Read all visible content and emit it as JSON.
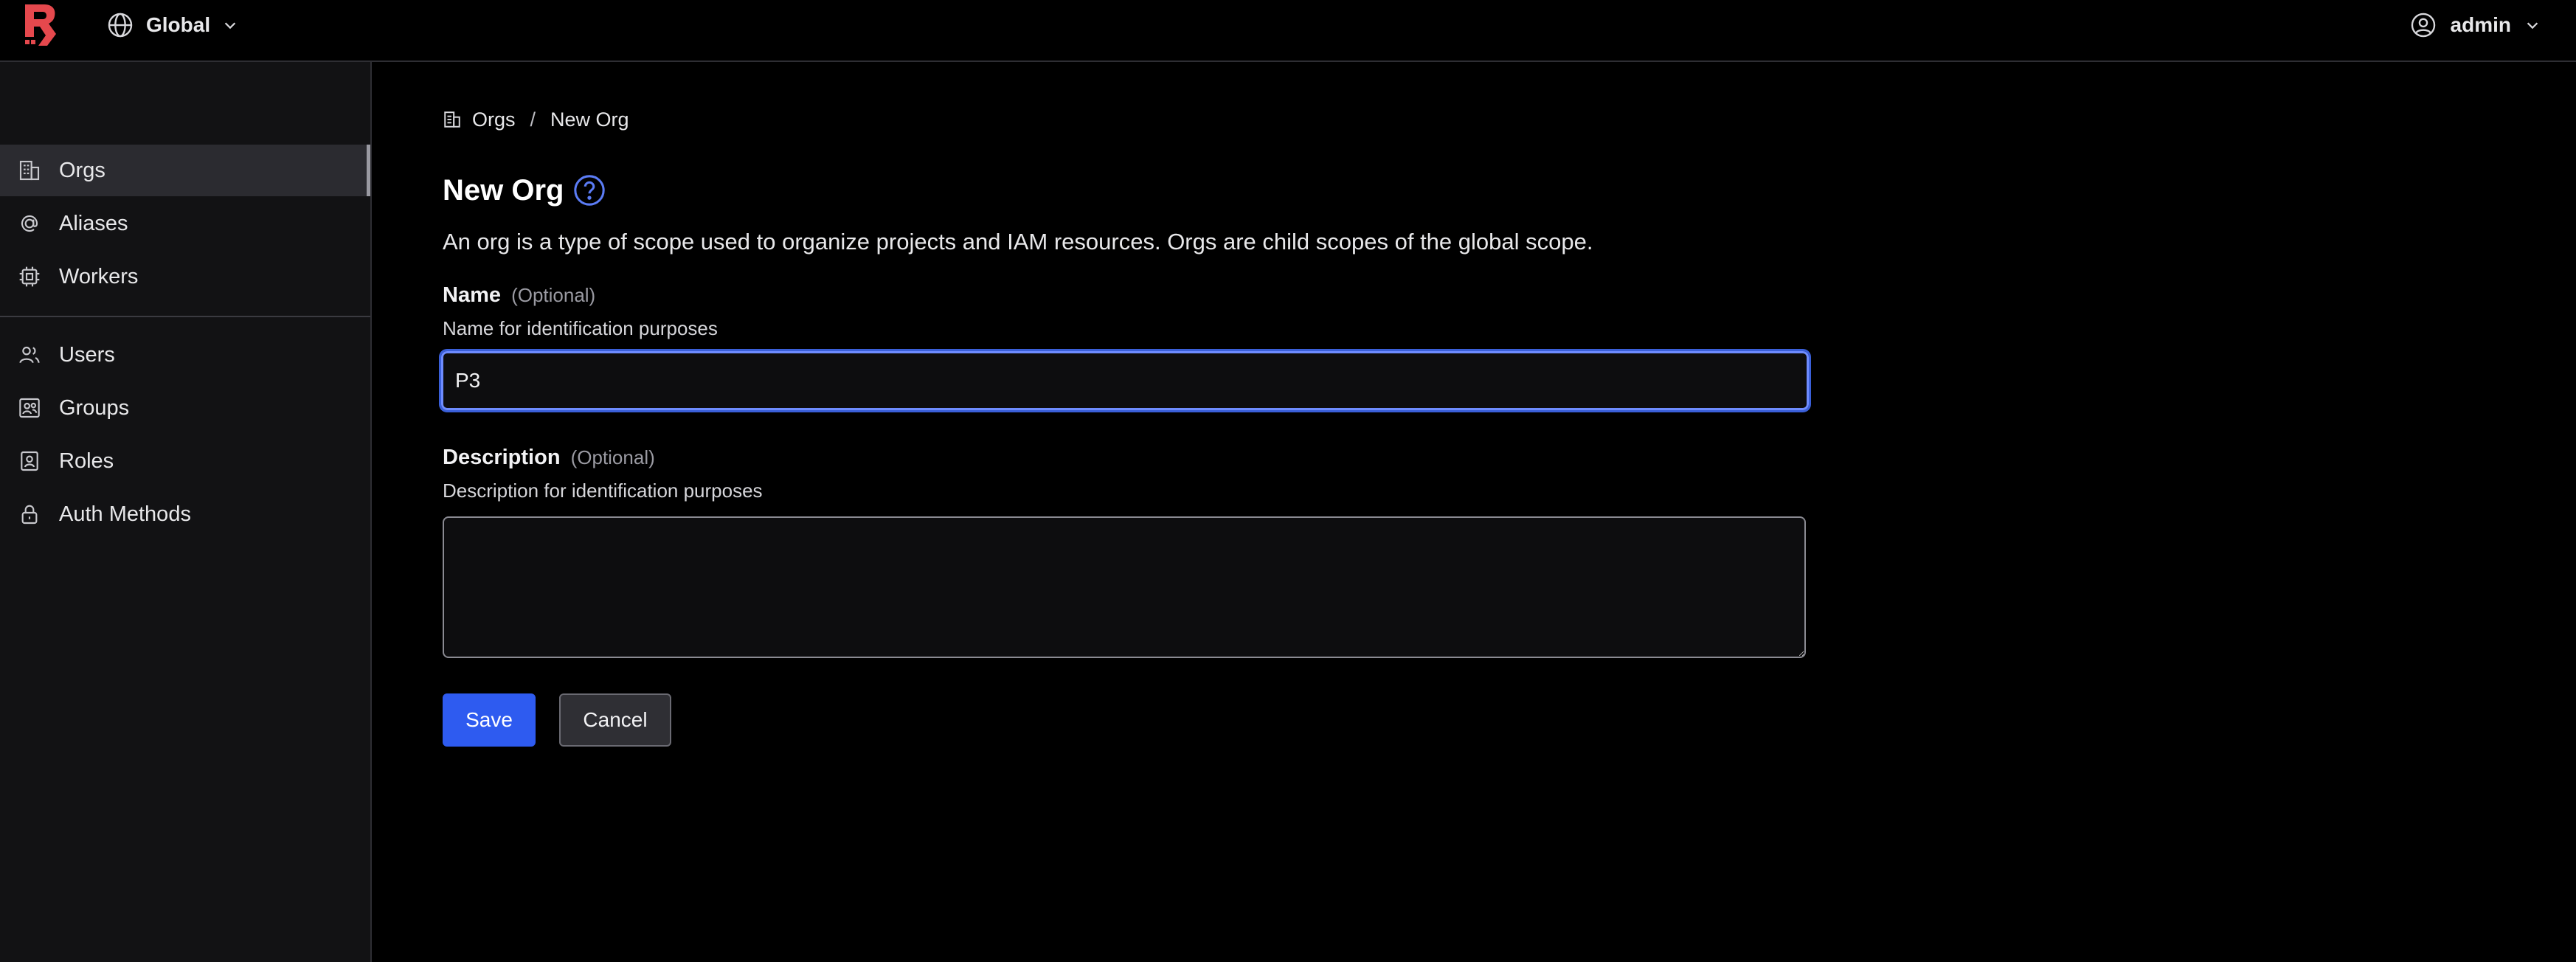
{
  "topbar": {
    "scope_label": "Global",
    "user_label": "admin"
  },
  "sidebar": {
    "items": [
      {
        "label": "Orgs",
        "icon": "building-icon",
        "active": true
      },
      {
        "label": "Aliases",
        "icon": "at-sign-icon",
        "active": false
      },
      {
        "label": "Workers",
        "icon": "cpu-icon",
        "active": false
      },
      {
        "label": "Users",
        "icon": "users-icon",
        "active": false
      },
      {
        "label": "Groups",
        "icon": "groups-icon",
        "active": false
      },
      {
        "label": "Roles",
        "icon": "id-badge-icon",
        "active": false
      },
      {
        "label": "Auth Methods",
        "icon": "lock-icon",
        "active": false
      }
    ]
  },
  "breadcrumb": {
    "parent": "Orgs",
    "separator": "/",
    "current": "New Org"
  },
  "page": {
    "title": "New Org",
    "description": "An org is a type of scope used to organize projects and IAM resources. Orgs are child scopes of the global scope."
  },
  "form": {
    "name": {
      "label": "Name",
      "optional": "(Optional)",
      "help": "Name for identification purposes",
      "value": "P3"
    },
    "description": {
      "label": "Description",
      "optional": "(Optional)",
      "help": "Description for identification purposes",
      "value": ""
    },
    "save_label": "Save",
    "cancel_label": "Cancel"
  },
  "colors": {
    "brand_red": "#e5484d",
    "accent_blue": "#2e5bf0",
    "focus_ring": "#6e8cff",
    "help_icon": "#5b7cf5"
  }
}
